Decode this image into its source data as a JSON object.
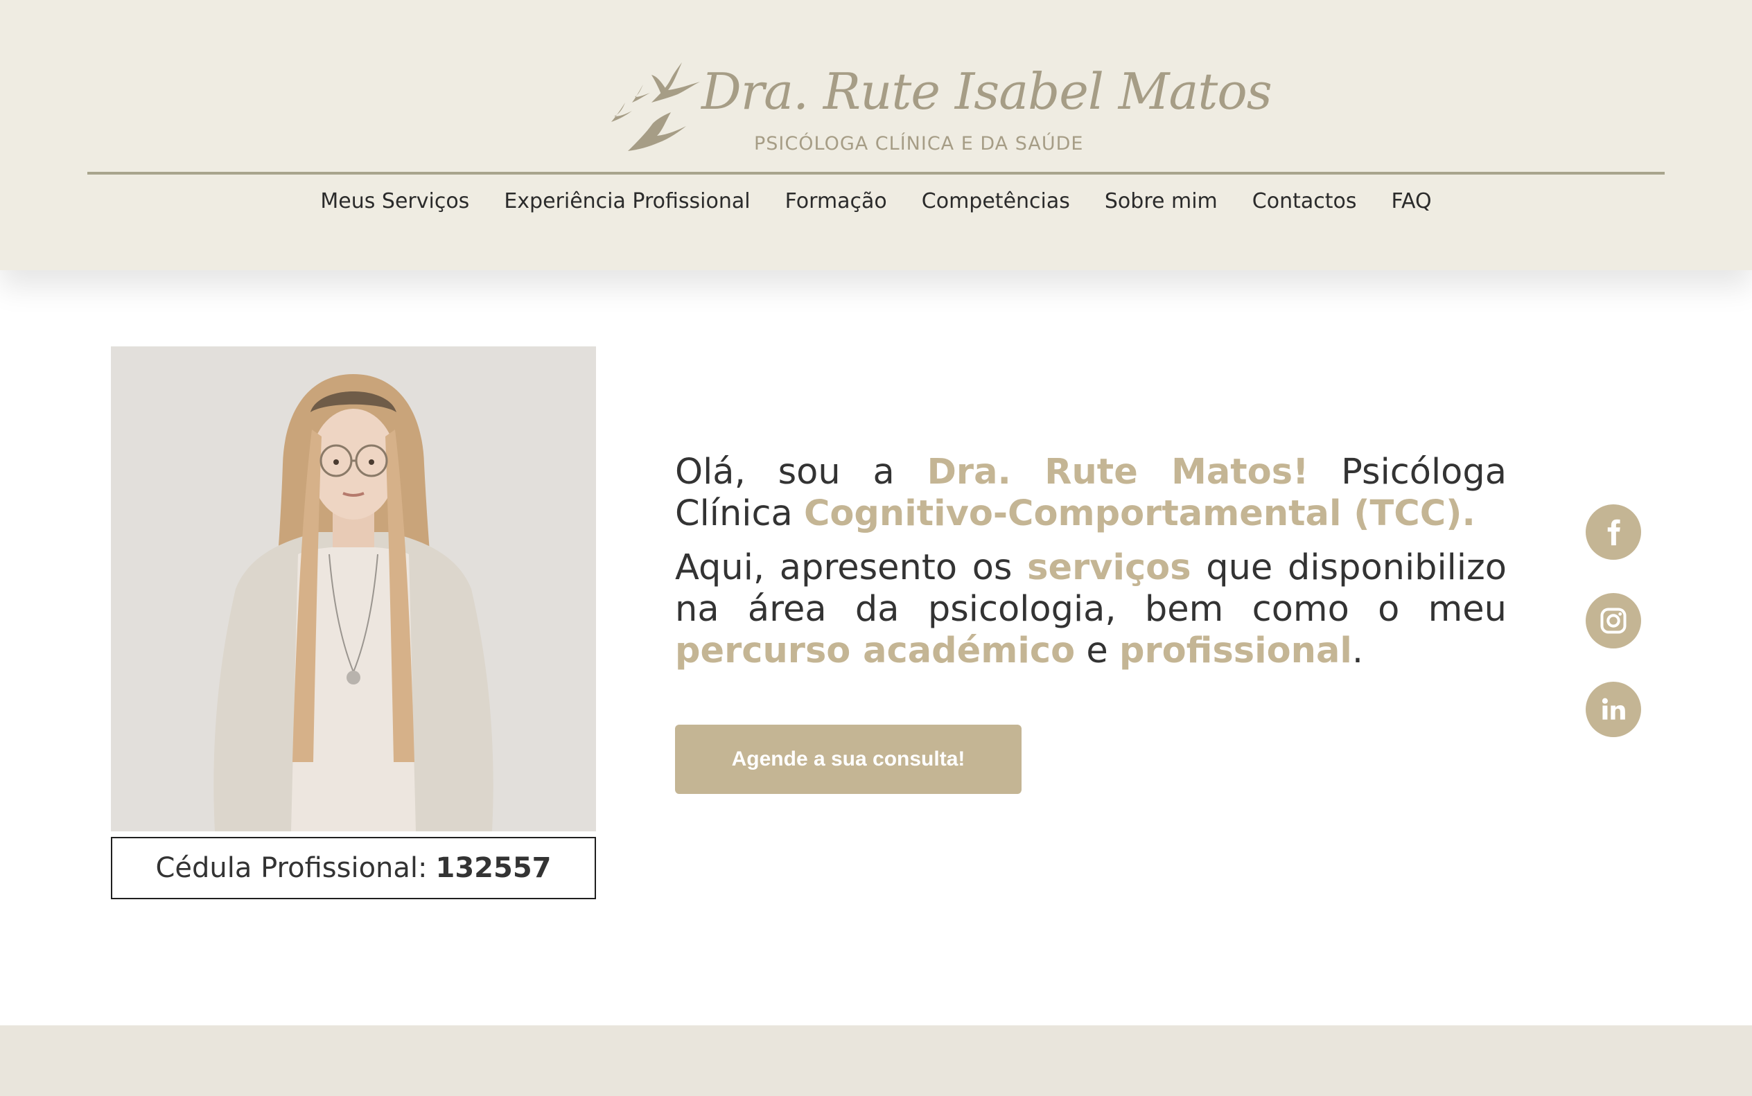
{
  "header": {
    "logo_name": "Dra. Rute Isabel Matos",
    "logo_subtitle": "PSICÓLOGA CLÍNICA E DA SAÚDE",
    "nav": [
      "Meus Serviços",
      "Experiência Profissional",
      "Formação",
      "Competências",
      "Sobre mim",
      "Contactos",
      "FAQ"
    ]
  },
  "hero": {
    "photo_alt": "Dra. Rute Matos",
    "cedula_label": "Cédula Profissional:",
    "cedula_number": "132557",
    "intro_1": {
      "t1": "Olá, sou a ",
      "hl1": "Dra. Rute Matos!",
      "t2": " Psicóloga Clínica ",
      "hl2": "Cognitivo-Comportamental (TCC)."
    },
    "intro_2": {
      "t1": "Aqui, apresento os ",
      "hl1": "serviços",
      "t2": " que disponibilizo na área da psicologia, bem como o meu ",
      "hl2": "percurso académico",
      "t3": " e ",
      "hl3": "profissional",
      "t4": "."
    },
    "cta_label": "Agende a sua consulta!"
  },
  "social": [
    "facebook-icon",
    "instagram-icon",
    "linkedin-icon"
  ],
  "colors": {
    "header_bg": "#efece2",
    "accent": "#c4b594",
    "logo": "#a69d86",
    "rule": "#a8a48d",
    "footer_bg": "#e9e5dc"
  }
}
